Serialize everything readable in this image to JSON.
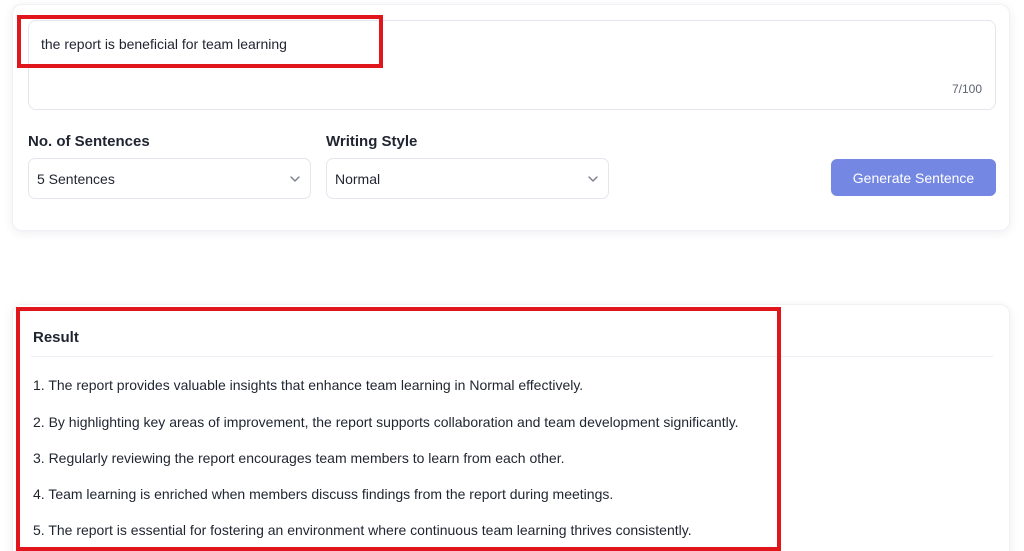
{
  "input": {
    "text": "the report is beneficial for team learning",
    "char_count": "7/100"
  },
  "options": {
    "sentences_label": "No. of Sentences",
    "sentences_value": "5 Sentences",
    "style_label": "Writing Style",
    "style_value": "Normal"
  },
  "actions": {
    "generate_label": "Generate Sentence"
  },
  "result": {
    "title": "Result",
    "sentences": [
      "1. The report provides valuable insights that enhance team learning in Normal effectively.",
      "2. By highlighting key areas of improvement, the report supports collaboration and team development significantly.",
      "3. Regularly reviewing the report encourages team members to learn from each other.",
      "4. Team learning is enriched when members discuss findings from the report during meetings.",
      "5. The report is essential for fostering an environment where continuous team learning thrives consistently."
    ]
  },
  "colors": {
    "accent_button": "#7487e3",
    "highlight": "#e1161d"
  }
}
